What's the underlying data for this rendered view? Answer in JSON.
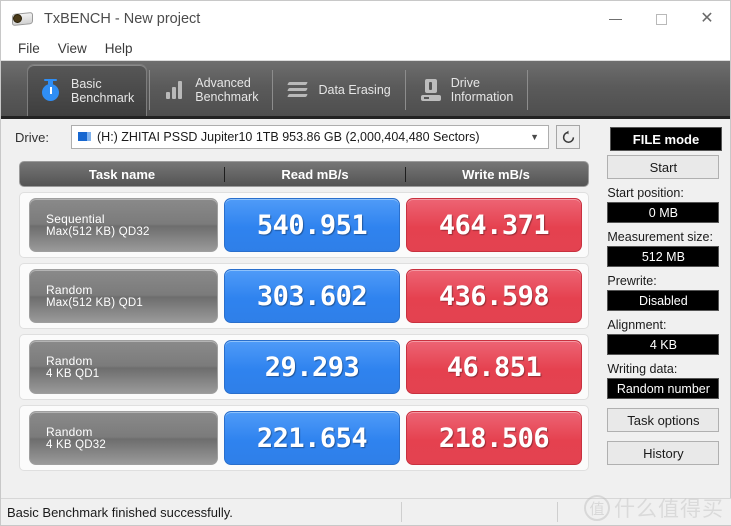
{
  "window": {
    "title": "TxBENCH - New project",
    "app_icon": "optical-disc-icon",
    "controls": {
      "minimize": "minimize-icon",
      "maximize": "maximize-icon",
      "close": "close-icon"
    }
  },
  "menu": {
    "items": [
      "File",
      "View",
      "Help"
    ]
  },
  "tabs": [
    {
      "label": "Basic\nBenchmark",
      "icon": "stopwatch-icon",
      "active": true
    },
    {
      "label": "Advanced\nBenchmark",
      "icon": "bar-chart-icon",
      "active": false
    },
    {
      "label": "Data Erasing",
      "icon": "wave-icon",
      "active": false
    },
    {
      "label": "Drive\nInformation",
      "icon": "drive-info-icon",
      "active": false
    }
  ],
  "drive": {
    "label": "Drive:",
    "icon": "drive-icon",
    "selected": "(H:) ZHITAI PSSD Jupiter10 1TB  953.86 GB (2,000,404,480 Sectors)",
    "dropdown_arrow": "chevron-down-icon",
    "refresh_icon": "refresh-icon"
  },
  "mode_button": {
    "label": "FILE mode"
  },
  "results": {
    "headers": [
      "Task name",
      "Read mB/s",
      "Write mB/s"
    ],
    "rows": [
      {
        "task_line1": "Sequential",
        "task_line2": "Max(512 KB) QD32",
        "read": "540.951",
        "write": "464.371"
      },
      {
        "task_line1": "Random",
        "task_line2": "Max(512 KB) QD1",
        "read": "303.602",
        "write": "436.598"
      },
      {
        "task_line1": "Random",
        "task_line2": "4 KB QD1",
        "read": "29.293",
        "write": "46.851"
      },
      {
        "task_line1": "Random",
        "task_line2": "4 KB QD32",
        "read": "221.654",
        "write": "218.506"
      }
    ]
  },
  "panel": {
    "start_button": "Start",
    "fields": [
      {
        "label": "Start position:",
        "value": "0 MB"
      },
      {
        "label": "Measurement size:",
        "value": "512 MB"
      },
      {
        "label": "Prewrite:",
        "value": "Disabled"
      },
      {
        "label": "Alignment:",
        "value": "4 KB"
      },
      {
        "label": "Writing data:",
        "value": "Random number"
      }
    ],
    "task_options_button": "Task options",
    "history_button": "History"
  },
  "status": {
    "message": "Basic Benchmark finished successfully."
  },
  "watermark": {
    "mark": "值",
    "text": "什么值得买"
  },
  "colors": {
    "read_chip": "#2f83ef",
    "write_chip": "#e5414f",
    "tab_bar": "#5b5b5b",
    "panel_bg": "#f0f0f0",
    "field_bg": "#000000"
  }
}
